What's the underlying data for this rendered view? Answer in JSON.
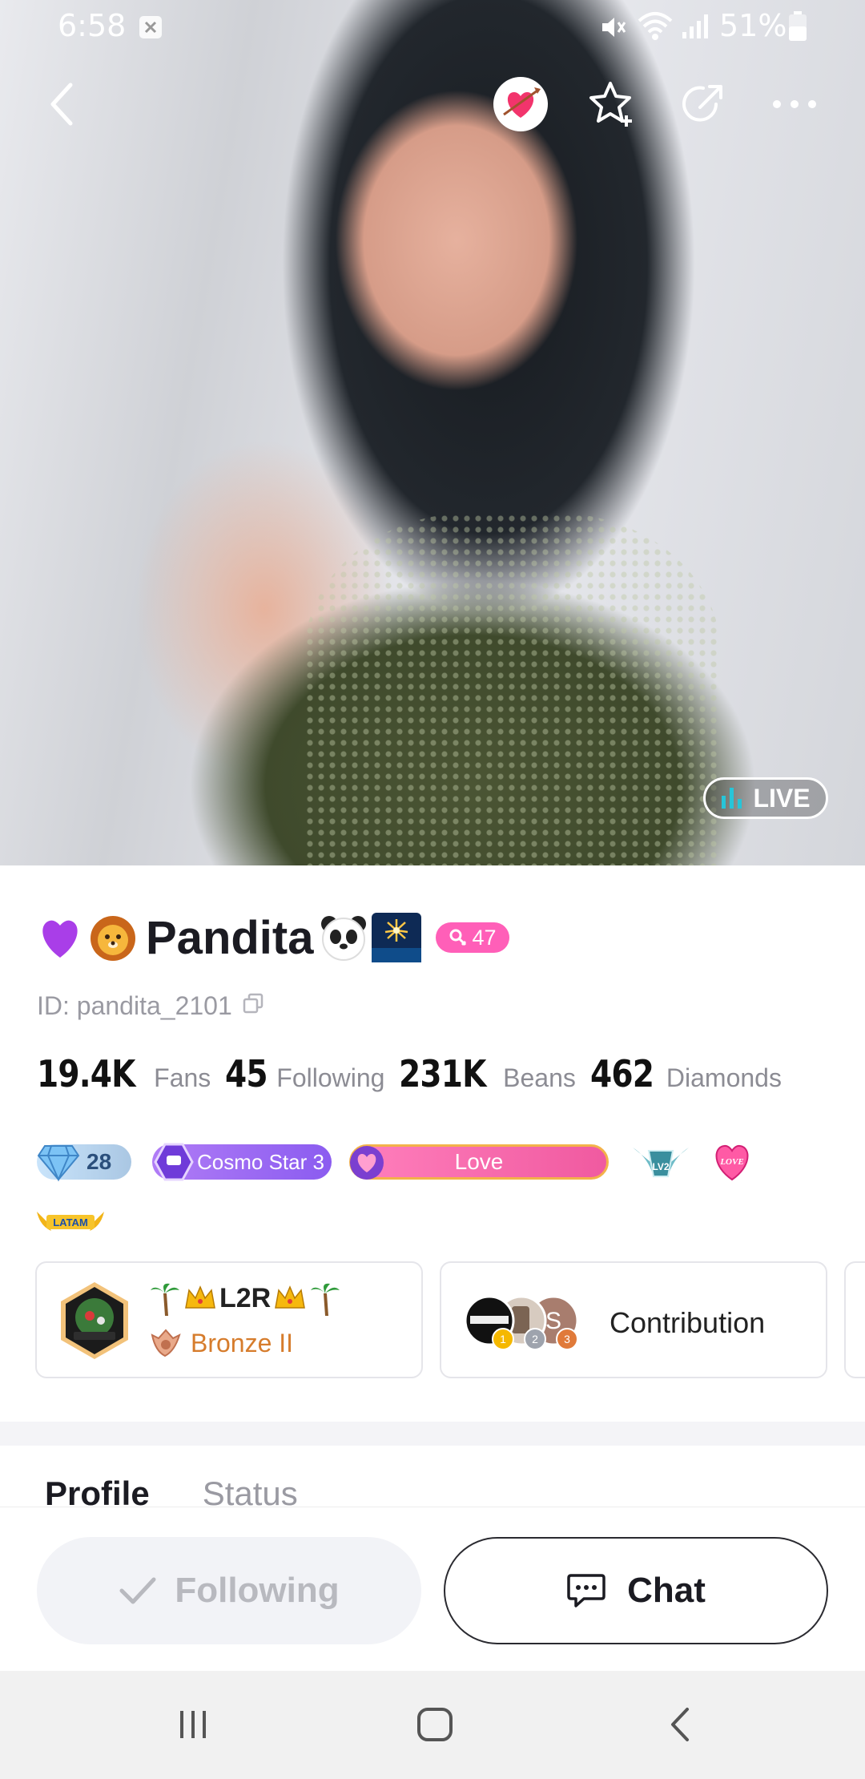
{
  "status_bar": {
    "time": "6:58",
    "battery": "51%"
  },
  "hero": {
    "live_label": "LIVE"
  },
  "profile": {
    "name": "Pandita",
    "level": "47",
    "id_text": "ID: pandita_2101",
    "stats": [
      {
        "value": "19.4K",
        "label": "Fans"
      },
      {
        "value": "45",
        "label": "Following"
      },
      {
        "value": "231K",
        "label": "Beans"
      },
      {
        "value": "462",
        "label": "Diamonds"
      }
    ],
    "badges": {
      "diamond_count": "28",
      "cosmo": "Cosmo Star 3",
      "love": "Love",
      "love_icon_text": "LOVE",
      "latam": "LATAM",
      "wing_badge": "LV2"
    }
  },
  "cards": {
    "family_name": "L2R",
    "family_rank": "Bronze II",
    "contribution_label": "Contribution",
    "contributor_ranks": [
      "1",
      "2",
      "3"
    ],
    "contributor_initial": "S"
  },
  "tabs": [
    {
      "label": "Profile"
    },
    {
      "label": "Status"
    }
  ],
  "actions": {
    "following_label": "Following",
    "chat_label": "Chat"
  },
  "colors": {
    "accent_pink": "#ff5fb8",
    "live_bar": "#27c5d8",
    "rank_orange": "#d67c2c"
  }
}
